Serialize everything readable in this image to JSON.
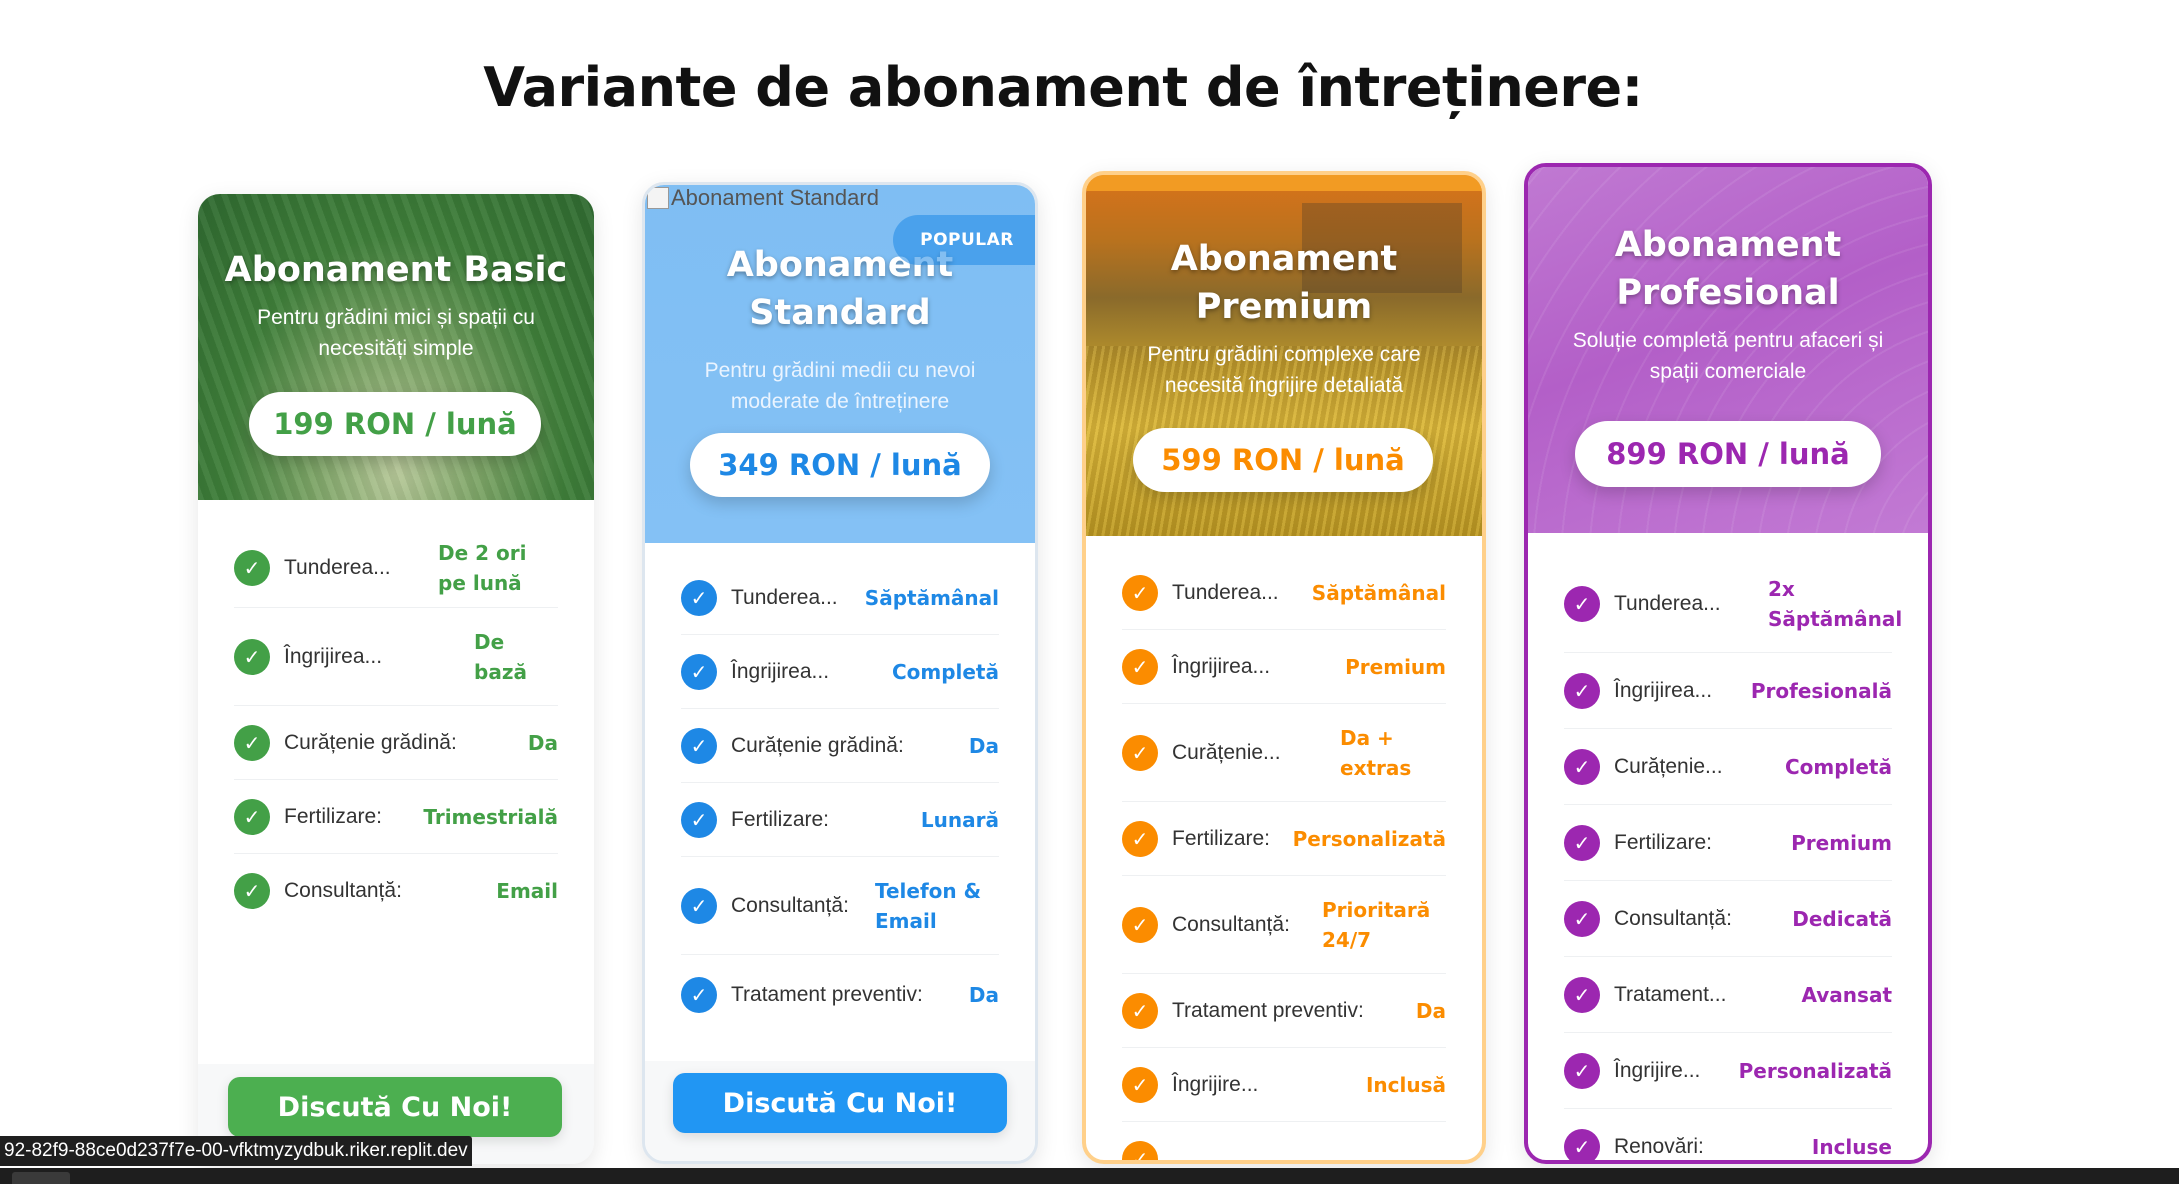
{
  "page": {
    "title": "Variante de abonament de întreținere:"
  },
  "colors": {
    "basic": "#43a047",
    "standard": "#1e88e5",
    "premium": "#fb8c00",
    "profesional": "#9c27b0"
  },
  "plans": [
    {
      "title": "Abonament Basic",
      "subtitle": "Pentru grădini mici și spații cu necesități simple",
      "price": "199 RON / lună",
      "features": [
        {
          "label": "Tunderea...",
          "value": "De 2 ori pe lună"
        },
        {
          "label": "Îngrijirea...",
          "value": "De bază"
        },
        {
          "label": "Curățenie grădină:",
          "value": "Da"
        },
        {
          "label": "Fertilizare:",
          "value": "Trimestrială"
        },
        {
          "label": "Consultanță:",
          "value": "Email"
        }
      ],
      "cta": "Discută Cu Noi!"
    },
    {
      "title": "Abonament Standard",
      "subtitle": "Pentru grădini medii cu nevoi moderate de întreținere",
      "price": "349 RON / lună",
      "badge": "POPULAR",
      "image_alt": "Abonament Standard",
      "features": [
        {
          "label": "Tunderea...",
          "value": "Săptămânal"
        },
        {
          "label": "Îngrijirea...",
          "value": "Completă"
        },
        {
          "label": "Curățenie grădină:",
          "value": "Da"
        },
        {
          "label": "Fertilizare:",
          "value": "Lunară"
        },
        {
          "label": "Consultanță:",
          "value": "Telefon & Email"
        },
        {
          "label": "Tratament preventiv:",
          "value": "Da"
        }
      ],
      "cta": "Discută Cu Noi!"
    },
    {
      "title": "Abonament Premium",
      "subtitle": "Pentru grădini complexe care necesită îngrijire detaliată",
      "price": "599 RON / lună",
      "features": [
        {
          "label": "Tunderea...",
          "value": "Săptămânal"
        },
        {
          "label": "Îngrijirea...",
          "value": "Premium"
        },
        {
          "label": "Curățenie...",
          "value": "Da + extras"
        },
        {
          "label": "Fertilizare:",
          "value": "Personalizată"
        },
        {
          "label": "Consultanță:",
          "value": "Prioritară 24/7"
        },
        {
          "label": "Tratament preventiv:",
          "value": "Da"
        },
        {
          "label": "Îngrijire...",
          "value": "Inclusă"
        }
      ]
    },
    {
      "title": "Abonament Profesional",
      "subtitle": "Soluție completă pentru afaceri și spații comerciale",
      "price": "899 RON / lună",
      "features": [
        {
          "label": "Tunderea...",
          "value": "2x Săptămânal"
        },
        {
          "label": "Îngrijirea...",
          "value": "Profesională"
        },
        {
          "label": "Curățenie...",
          "value": "Completă"
        },
        {
          "label": "Fertilizare:",
          "value": "Premium"
        },
        {
          "label": "Consultanță:",
          "value": "Dedicată"
        },
        {
          "label": "Tratament...",
          "value": "Avansat"
        },
        {
          "label": "Îngrijire...",
          "value": "Personalizată"
        },
        {
          "label": "Renovări:",
          "value": "Incluse"
        }
      ]
    }
  ],
  "statusbar": {
    "url": "92-82f9-88ce0d237f7e-00-vfktmyzydbuk.riker.replit.dev"
  },
  "icons": {
    "check": "check-icon",
    "broken_image": "broken-image-icon"
  }
}
